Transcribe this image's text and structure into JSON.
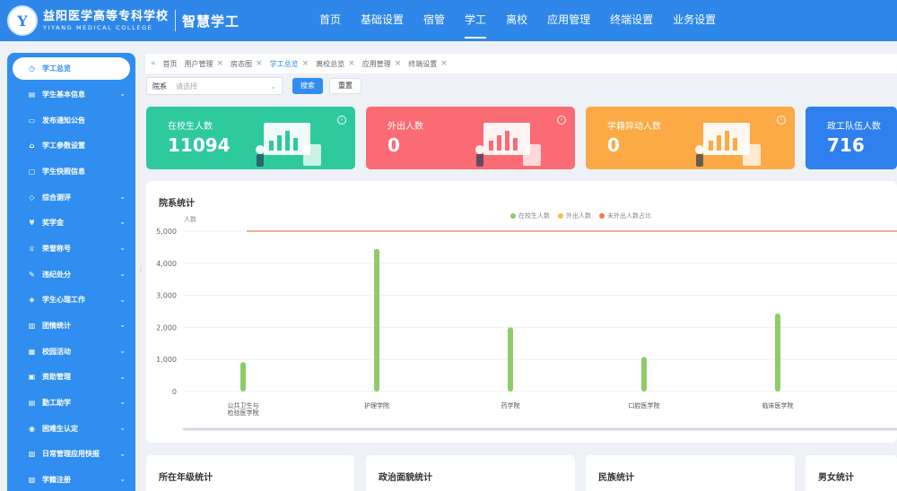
{
  "app": {
    "logo_cn": "益阳医学高等专科学校",
    "logo_en": "YIYANG MEDICAL COLLEGE",
    "system_name": "智慧学工"
  },
  "nav": {
    "items": [
      {
        "label": "首页",
        "active": false
      },
      {
        "label": "基础设置",
        "active": false
      },
      {
        "label": "宿管",
        "active": false
      },
      {
        "label": "学工",
        "active": true
      },
      {
        "label": "离校",
        "active": false
      },
      {
        "label": "应用管理",
        "active": false
      },
      {
        "label": "终端设置",
        "active": false
      },
      {
        "label": "业务设置",
        "active": false
      }
    ]
  },
  "sidebar": {
    "items": [
      {
        "label": "学工总览",
        "icon": "clock-icon",
        "glyph": "◷",
        "chevron": false,
        "active": true
      },
      {
        "label": "学生基本信息",
        "icon": "profile-icon",
        "glyph": "▤",
        "chevron": true
      },
      {
        "label": "发布通知公告",
        "icon": "notice-icon",
        "glyph": "▭",
        "chevron": false
      },
      {
        "label": "学工参数设置",
        "icon": "settings-icon",
        "glyph": "⌂",
        "chevron": false
      },
      {
        "label": "学生快照信息",
        "icon": "snapshot-icon",
        "glyph": "▢",
        "chevron": false
      },
      {
        "label": "综合测评",
        "icon": "assessment-icon",
        "glyph": "◇",
        "chevron": true
      },
      {
        "label": "奖学金",
        "icon": "yen-icon",
        "glyph": "¥",
        "chevron": true
      },
      {
        "label": "荣誉称号",
        "icon": "honor-icon",
        "glyph": "♕",
        "chevron": true
      },
      {
        "label": "违纪处分",
        "icon": "edit-icon",
        "glyph": "✎",
        "chevron": true
      },
      {
        "label": "学生心理工作",
        "icon": "psychology-icon",
        "glyph": "◈",
        "chevron": true
      },
      {
        "label": "团情统计",
        "icon": "stats-icon",
        "glyph": "▥",
        "chevron": true
      },
      {
        "label": "校园活动",
        "icon": "activity-icon",
        "glyph": "▦",
        "chevron": true
      },
      {
        "label": "资助管理",
        "icon": "funding-icon",
        "glyph": "▣",
        "chevron": true
      },
      {
        "label": "勤工助学",
        "icon": "work-study-icon",
        "glyph": "▤",
        "chevron": true
      },
      {
        "label": "困难生认定",
        "icon": "user-icon",
        "glyph": "◉",
        "chevron": true
      },
      {
        "label": "日常管理应用快报",
        "icon": "report-icon",
        "glyph": "▧",
        "chevron": true
      },
      {
        "label": "学籍注册",
        "icon": "register-icon",
        "glyph": "▨",
        "chevron": true
      }
    ]
  },
  "tabs": {
    "items": [
      {
        "label": "首页",
        "closable": false,
        "active": false
      },
      {
        "label": "用户管理",
        "closable": true,
        "active": false
      },
      {
        "label": "房态图",
        "closable": true,
        "active": false
      },
      {
        "label": "学工总览",
        "closable": true,
        "active": true
      },
      {
        "label": "离校总览",
        "closable": true,
        "active": false
      },
      {
        "label": "应用管理",
        "closable": true,
        "active": false
      },
      {
        "label": "终端设置",
        "closable": true,
        "active": false
      }
    ]
  },
  "search": {
    "field_label": "院系",
    "placeholder": "请选择",
    "search_label": "搜索",
    "reset_label": "重置"
  },
  "cards": [
    {
      "title": "在校生人数",
      "value": "11094",
      "color": "#2fc99e"
    },
    {
      "title": "外出人数",
      "value": "0",
      "color": "#fb6b73"
    },
    {
      "title": "学籍异动人数",
      "value": "0",
      "color": "#fcaa45"
    },
    {
      "title": "政工队伍人数",
      "value": "716",
      "color": "#2f80ee"
    }
  ],
  "chart_panel": {
    "title": "院系统计",
    "unit": "人数",
    "legend": [
      {
        "label": "在校生人数",
        "color": "#8fcb6a"
      },
      {
        "label": "外出人数",
        "color": "#f5c342"
      },
      {
        "label": "未外出人数占比",
        "color": "#ee7b55"
      }
    ]
  },
  "chart_data": {
    "type": "bar",
    "title": "院系统计",
    "ylabel": "人数",
    "ylim": [
      0,
      5000
    ],
    "yticks": [
      "0",
      "1,000",
      "2,000",
      "3,000",
      "4,000",
      "5,000"
    ],
    "categories": [
      "公共卫生与\n检验医学院",
      "护理学院",
      "药学院",
      "口腔医学院",
      "临床医学院"
    ],
    "series": [
      {
        "name": "在校生人数",
        "type": "bar",
        "color": "#8fcb6a",
        "values": [
          920,
          4450,
          2000,
          1080,
          2430
        ]
      },
      {
        "name": "外出人数",
        "type": "bar",
        "color": "#f5c342",
        "values": [
          0,
          0,
          0,
          0,
          0
        ]
      },
      {
        "name": "未外出人数占比",
        "type": "line",
        "color": "#ee7b55",
        "values": [
          5000,
          5000,
          5000,
          5000,
          5000
        ]
      }
    ],
    "legend_position": "top-center",
    "grid": true
  },
  "bottom_panels": [
    {
      "title": "所在年级统计"
    },
    {
      "title": "政治面貌统计"
    },
    {
      "title": "民族统计"
    },
    {
      "title": "男女统计"
    }
  ]
}
